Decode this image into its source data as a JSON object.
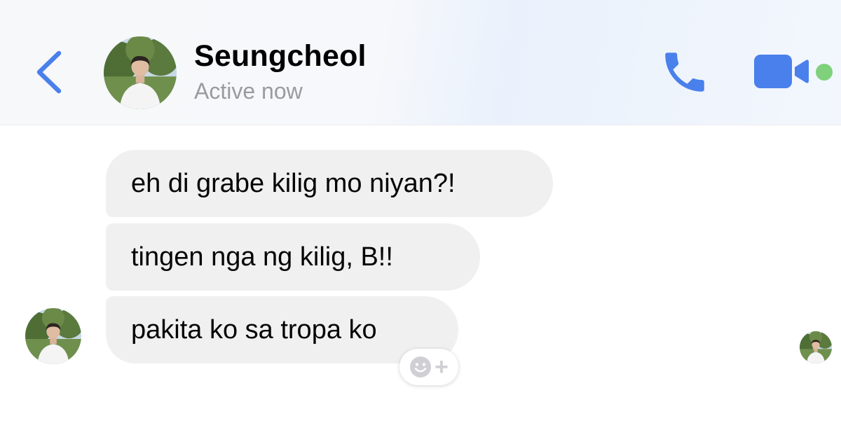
{
  "header": {
    "contact_name": "Seungcheol",
    "status": "Active now",
    "icons": {
      "back": "chevron-left-icon",
      "call": "phone-icon",
      "video": "video-camera-icon",
      "presence": "active-status-dot"
    },
    "colors": {
      "accent": "#4a80ec",
      "active_dot": "#7fd27b"
    }
  },
  "messages": [
    {
      "text": "eh di grabe kilig mo niyan?!"
    },
    {
      "text": "tingen nga ng kilig, B!!"
    },
    {
      "text": "pakita ko sa tropa ko"
    }
  ],
  "reaction_button": {
    "icon": "smiley-icon",
    "plus": "+"
  },
  "colors": {
    "bubble_bg": "#f0f0f0",
    "text": "#050505",
    "status_text": "#9a9a9f"
  }
}
